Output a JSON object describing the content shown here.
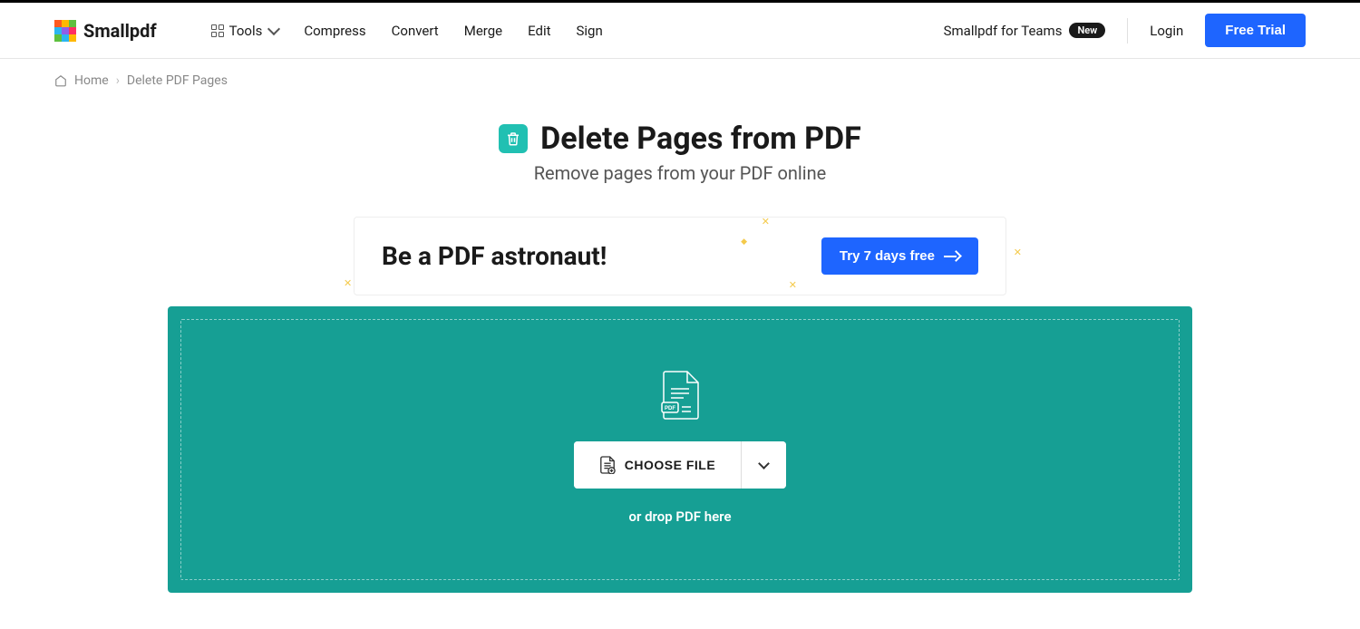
{
  "brand": "Smallpdf",
  "nav": {
    "tools": "Tools",
    "compress": "Compress",
    "convert": "Convert",
    "merge": "Merge",
    "edit": "Edit",
    "sign": "Sign"
  },
  "header_right": {
    "teams": "Smallpdf for Teams",
    "teams_badge": "New",
    "login": "Login",
    "free_trial": "Free Trial"
  },
  "breadcrumb": {
    "home": "Home",
    "current": "Delete PDF Pages"
  },
  "page": {
    "title": "Delete Pages from PDF",
    "subtitle": "Remove pages from your PDF online"
  },
  "promo": {
    "headline": "Be a PDF astronaut!",
    "cta": "Try 7 days free"
  },
  "dropzone": {
    "choose_label": "CHOOSE FILE",
    "drop_text": "or drop PDF here"
  },
  "logo_colors": [
    "#ff5a1f",
    "#ffb800",
    "#5ec03f",
    "#2bb6f0",
    "#8f5fe8",
    "#ff2e63",
    "#5ec03f",
    "#2bb6f0",
    "#ffb800"
  ]
}
